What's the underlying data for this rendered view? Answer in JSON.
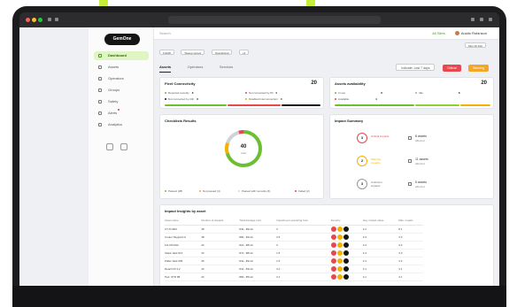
{
  "colors": {
    "brand_green": "#8fce2c",
    "critical": "#e5484d",
    "warning": "#f5b100",
    "ok": "#6bbf33",
    "dark": "#151515"
  },
  "app": {
    "logo": "GemOne"
  },
  "sidebar": {
    "items": [
      {
        "label": "Dashboard",
        "icon": "grid-icon"
      },
      {
        "label": "Assets",
        "icon": "truck-icon"
      },
      {
        "label": "Operators",
        "icon": "person-icon"
      },
      {
        "label": "Groups",
        "icon": "group-icon"
      },
      {
        "label": "Safety",
        "icon": "shield-icon"
      },
      {
        "label": "Alerts",
        "icon": "bell-icon"
      },
      {
        "label": "Analytics",
        "icon": "chart-icon"
      }
    ]
  },
  "topbar": {
    "search_placeholder": "Search",
    "sites": "All Sites",
    "user": "Austin Robinson"
  },
  "filters": {
    "chips": [
      "Forklift",
      "Sweep sensor",
      "Operational",
      "+2"
    ],
    "date": "Mon 20 Feb"
  },
  "tabs": [
    {
      "label": "Assets"
    },
    {
      "label": "Operators"
    },
    {
      "label": "Services"
    }
  ],
  "actions": {
    "period": "Indicate: Last 7 days",
    "btn_red": "Critical",
    "btn_orange": "Warning"
  },
  "fleet": {
    "title": "Fleet Connectivity",
    "count": "20",
    "rows": [
      {
        "label": "Reported recently",
        "value": "8",
        "label2": "Not connected by 8h",
        "value2": "0"
      },
      {
        "label": "Not connected by 24h",
        "value": "8",
        "label2": "Disabled interconnection",
        "value2": "0"
      }
    ]
  },
  "avail": {
    "title": "Assets availability",
    "count": "20",
    "rows": [
      {
        "label": "In use",
        "value": "8",
        "label2": "Idle",
        "value2": "8"
      },
      {
        "label": "Available",
        "value": "4"
      }
    ]
  },
  "checklist": {
    "title": "Checklists Results",
    "center": "40",
    "center_sub": "total",
    "legend": [
      "Passed (28)",
      "Not passed (4)",
      "Passed with remarks (6)",
      "Failed (2)"
    ]
  },
  "impact": {
    "title": "Impact Summary",
    "items": [
      {
        "count": "3",
        "label": "Critical impacts",
        "assets": "8 assets",
        "sub": "affected"
      },
      {
        "count": "2",
        "label": "Warning impacts",
        "assets": "11 assets",
        "sub": "affected"
      },
      {
        "count": "3",
        "label": "Unknown impacts",
        "assets": "5 assets",
        "sub": "affected"
      }
    ]
  },
  "insights": {
    "title": "Impact Insights by asset",
    "columns": [
      "Asset name",
      "Number of impacts",
      "Total damage cost",
      "Impacts per operating hour",
      "Severity",
      "Avg. impact value",
      "Max. impact"
    ],
    "rows": [
      [
        "CT-Tcr003",
        "48",
        "€4k - €9min",
        "3",
        "2.2",
        "8.1"
      ],
      [
        "Cooler Skyglord A",
        "48",
        "€8k - €4min",
        "2.5",
        "2.3",
        "3.3"
      ],
      [
        "FH-CP1192",
        "44",
        "€2k - €8min",
        "3",
        "2.3",
        "3.3"
      ],
      [
        "Stack Jack 012",
        "44",
        "€7k - €8min",
        "1.5",
        "2.4",
        "3.3"
      ],
      [
        "Pallet Jack 005",
        "45",
        "€4k - €9min",
        "1.5",
        "2.4",
        "3.3"
      ],
      [
        "Reach lift 3.2",
        "43",
        "€4k - €3min",
        "3.2",
        "3.1",
        "3.1"
      ],
      [
        "Ped. STR 98",
        "44",
        "€8k - €5min",
        "3.1",
        "3.1",
        "3.1"
      ]
    ]
  }
}
